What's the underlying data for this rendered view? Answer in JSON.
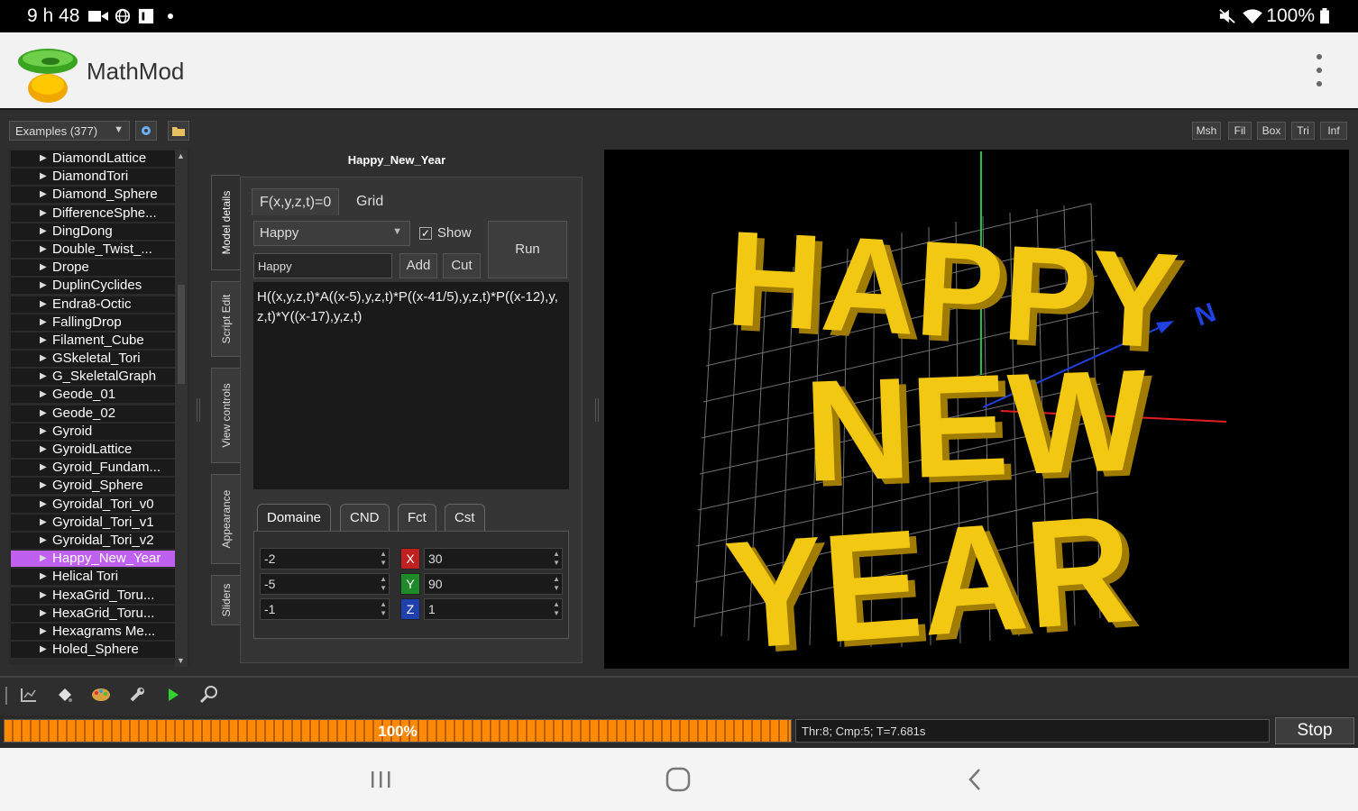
{
  "status_bar": {
    "time": "9 h 48",
    "battery": "100%",
    "icons": [
      "video-icon",
      "globe-icon",
      "notification-icon",
      "mute-icon",
      "wifi-icon",
      "battery-icon"
    ]
  },
  "app_bar": {
    "title": "MathMod",
    "menu_icon": "more-vert-icon"
  },
  "controls": {
    "examples_combo": "Examples (377)",
    "view_buttons": [
      "Msh",
      "Fil",
      "Box",
      "Tri",
      "Inf"
    ]
  },
  "model_list": {
    "items": [
      "DiamondLattice",
      "DiamondTori",
      "Diamond_Sphere",
      "DifferenceSphe...",
      "DingDong",
      "Double_Twist_...",
      "Drope",
      "DuplinCyclides",
      "Endra8-Octic",
      "FallingDrop",
      "Filament_Cube",
      "GSkeletal_Tori",
      "G_SkeletalGraph",
      "Geode_01",
      "Geode_02",
      "Gyroid",
      "GyroidLattice",
      "Gyroid_Fundam...",
      "Gyroid_Sphere",
      "Gyroidal_Tori_v0",
      "Gyroidal_Tori_v1",
      "Gyroidal_Tori_v2",
      "Happy_New_Year",
      "Helical Tori",
      "HexaGrid_Toru...",
      "HexaGrid_Toru...",
      "Hexagrams Me...",
      "Holed_Sphere"
    ],
    "selected": "Happy_New_Year"
  },
  "vertical_tabs": [
    "Model details",
    "Script Edit",
    "View controls",
    "Appearance",
    "Sliders"
  ],
  "editor": {
    "model_name": "Happy_New_Year",
    "tabs": [
      "F(x,y,z,t)=0",
      "Grid"
    ],
    "function_combo": "Happy",
    "show_label": "Show",
    "show_checked": "✓",
    "name_field": "Happy",
    "add_button": "Add",
    "cut_button": "Cut",
    "run_button": "Run",
    "formula": "H((x,y,z,t)*A((x-5),y,z,t)*P((x-41/5),y,z,t)*P((x-12),y,z,t)*Y((x-17),y,z,t)",
    "bottom_tabs": [
      "Domaine",
      "CND",
      "Fct",
      "Cst"
    ],
    "domain": {
      "min_values": [
        "-2",
        "-5",
        "-1"
      ],
      "axes": [
        "X",
        "Y",
        "Z"
      ],
      "grid_values": [
        "30",
        "90",
        "1"
      ]
    }
  },
  "viewport": {
    "text_lines": [
      "HAPPY",
      "NEW",
      "YEAR"
    ],
    "axis_label": "N",
    "colors": {
      "text": "#f2c812",
      "text_shadow": "#a07c00",
      "grid": "#cfcfcf",
      "x_axis": "#e02020",
      "y_axis": "#20c040",
      "z_axis": "#2040e0"
    }
  },
  "toolbar": {
    "icons": [
      "chart-icon",
      "paint-icon",
      "palette-icon",
      "wrench-icon",
      "play-icon",
      "search-icon"
    ]
  },
  "progress": {
    "label": "100%",
    "value": 100,
    "status": "Thr:8; Cmp:5; T=7.681s",
    "stop_button": "Stop"
  },
  "nav_bar": {
    "buttons": [
      "recents-icon",
      "home-icon",
      "back-icon"
    ]
  },
  "accent_colors": {
    "selection": "#c060f0",
    "progress": "#ff8a00"
  }
}
